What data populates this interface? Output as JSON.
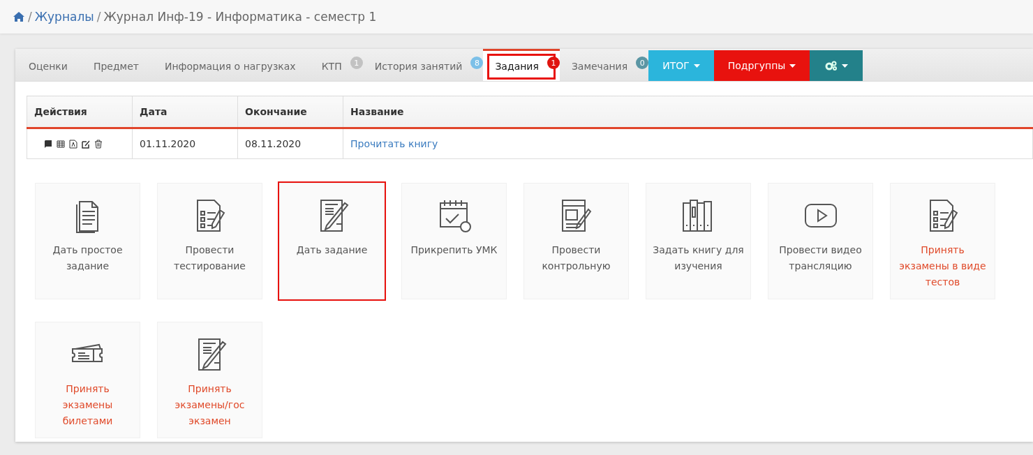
{
  "breadcrumb": {
    "links": [
      {
        "sep": "/",
        "label": "Журналы"
      }
    ],
    "current": {
      "sep": "/",
      "label": "Журнал Инф-19 - Информатика - семестр 1"
    }
  },
  "tabs": [
    {
      "label": "Оценки",
      "selected": false,
      "highlighted": false
    },
    {
      "label": "Предмет",
      "selected": false,
      "highlighted": false
    },
    {
      "label": "Информация о нагрузках",
      "selected": false,
      "highlighted": false
    },
    {
      "label": "КТП",
      "badge": "1",
      "color": "#c2c2c2",
      "selected": false,
      "highlighted": false
    },
    {
      "label": "История занятий",
      "badge": "8",
      "color": "#7cc0e8",
      "selected": false,
      "highlighted": false
    },
    {
      "label": "Задания",
      "badge": "1",
      "color": "#e0140f",
      "selected": true,
      "highlighted": true
    },
    {
      "label": "Замечания",
      "badge": "0",
      "color": "#5b96a4",
      "selected": false,
      "highlighted": false
    }
  ],
  "buttons": [
    {
      "kind": "dropdown",
      "label": "ИТОГ",
      "color": "#2bb5dc"
    },
    {
      "kind": "dropdown",
      "label": "Подргуппы",
      "color": "#e8120e"
    },
    {
      "kind": "gear",
      "color": "#23818a"
    }
  ],
  "table": {
    "columns": [
      "Действия",
      "Дата",
      "Окончание",
      "Название"
    ],
    "rows": [
      {
        "date": "01.11.2020",
        "end": "08.11.2020",
        "title": "Прочитать книгу"
      }
    ]
  },
  "tiles": [
    {
      "kind": "document",
      "label": "Дать простое задание",
      "exam": false,
      "highlighted": false
    },
    {
      "kind": "checklist",
      "label": "Провести тестирование",
      "exam": false,
      "highlighted": false
    },
    {
      "kind": "signing",
      "label": "Дать задание",
      "exam": false,
      "highlighted": true
    },
    {
      "kind": "calendar",
      "label": "Прикрепить УМК",
      "exam": false,
      "highlighted": false
    },
    {
      "kind": "newspaper",
      "label": "Провести контрольную",
      "exam": false,
      "highlighted": false
    },
    {
      "kind": "books",
      "label": "Задать книгу для изучения",
      "exam": false,
      "highlighted": false
    },
    {
      "kind": "video",
      "label": "Провести видео трансляцию",
      "exam": false,
      "highlighted": false
    },
    {
      "kind": "checklist",
      "label": "Принять экзамены в виде тестов",
      "exam": true,
      "highlighted": false
    },
    {
      "kind": "ticket",
      "label": "Принять экзамены билетами",
      "exam": true,
      "highlighted": false
    },
    {
      "kind": "signing",
      "label": "Принять экзамены/гос экзамен",
      "exam": true,
      "highlighted": false
    }
  ]
}
